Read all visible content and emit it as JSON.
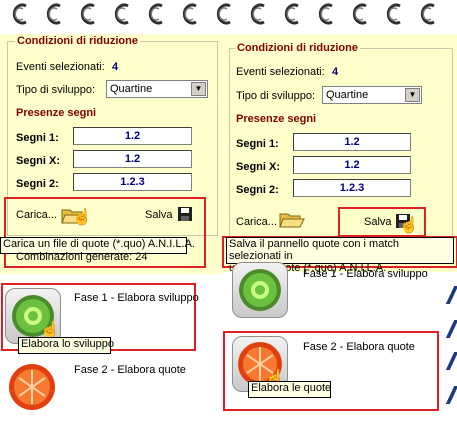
{
  "left": {
    "legend": "Condizioni di riduzione",
    "eventi_label": "Eventi selezionati:",
    "eventi_value": "4",
    "tipo_label": "Tipo di sviluppo:",
    "tipo_value": "Quartine",
    "presenze": "Presenze segni",
    "segni": [
      {
        "label": "Segni 1:",
        "value": "1.2"
      },
      {
        "label": "Segni X:",
        "value": "1.2"
      },
      {
        "label": "Segni 2:",
        "value": "1.2.3"
      }
    ],
    "carica_label": "Carica...",
    "salva_label": "Salva",
    "tooltip_carica": "Carica un file di quote (*.quo) A.N.I.L.A.",
    "combinazioni": "Combinazioni generate:  24",
    "fase1_label": "Fase 1 - Elabora sviluppo",
    "fase1_tooltip": "Elabora lo sviluppo",
    "fase2_label": "Fase 2 - Elabora quote"
  },
  "right": {
    "legend": "Condizioni di riduzione",
    "eventi_label": "Eventi selezionati:",
    "eventi_value": "4",
    "tipo_label": "Tipo di sviluppo:",
    "tipo_value": "Quartine",
    "presenze": "Presenze segni",
    "segni": [
      {
        "label": "Segni 1:",
        "value": "1.2"
      },
      {
        "label": "Segni X:",
        "value": "1.2"
      },
      {
        "label": "Segni 2:",
        "value": "1.2.3"
      }
    ],
    "carica_label": "Carica...",
    "salva_label": "Salva",
    "tooltip_salva_line1": "Salva il pannello quote con i match selezionati in",
    "tooltip_salva_line2": "un file di quote (*.quo) A.N.I.L.A.",
    "fase1_label": "Fase 1 - Elabora sviluppo",
    "fase2_label": "Fase 2 - Elabora quote",
    "fase2_tooltip": "Elabora le quote"
  },
  "colors": {
    "panel_bg": "#ffffcc",
    "legend_text": "#800000",
    "value_text": "#000080",
    "highlight_border": "#e02020"
  }
}
